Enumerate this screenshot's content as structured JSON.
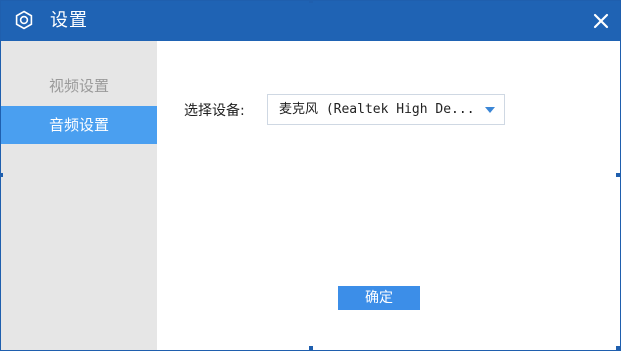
{
  "window": {
    "title": "设置",
    "title_icon": "settings-gear-icon",
    "close_icon": "close-icon",
    "close_label": "×"
  },
  "sidebar": {
    "items": [
      {
        "label": "视频设置",
        "selected": false
      },
      {
        "label": "音频设置",
        "selected": true
      }
    ]
  },
  "main": {
    "device_label": "选择设备:",
    "device_select": {
      "value": "麦克风 (Realtek High De...",
      "icon": "chevron-down-icon"
    },
    "ok_label": "确定"
  },
  "colors": {
    "titlebar": "#1f63b4",
    "sidebar_bg": "#e6e6e6",
    "selected_item": "#4a9ff0",
    "button": "#3c8ee8"
  }
}
